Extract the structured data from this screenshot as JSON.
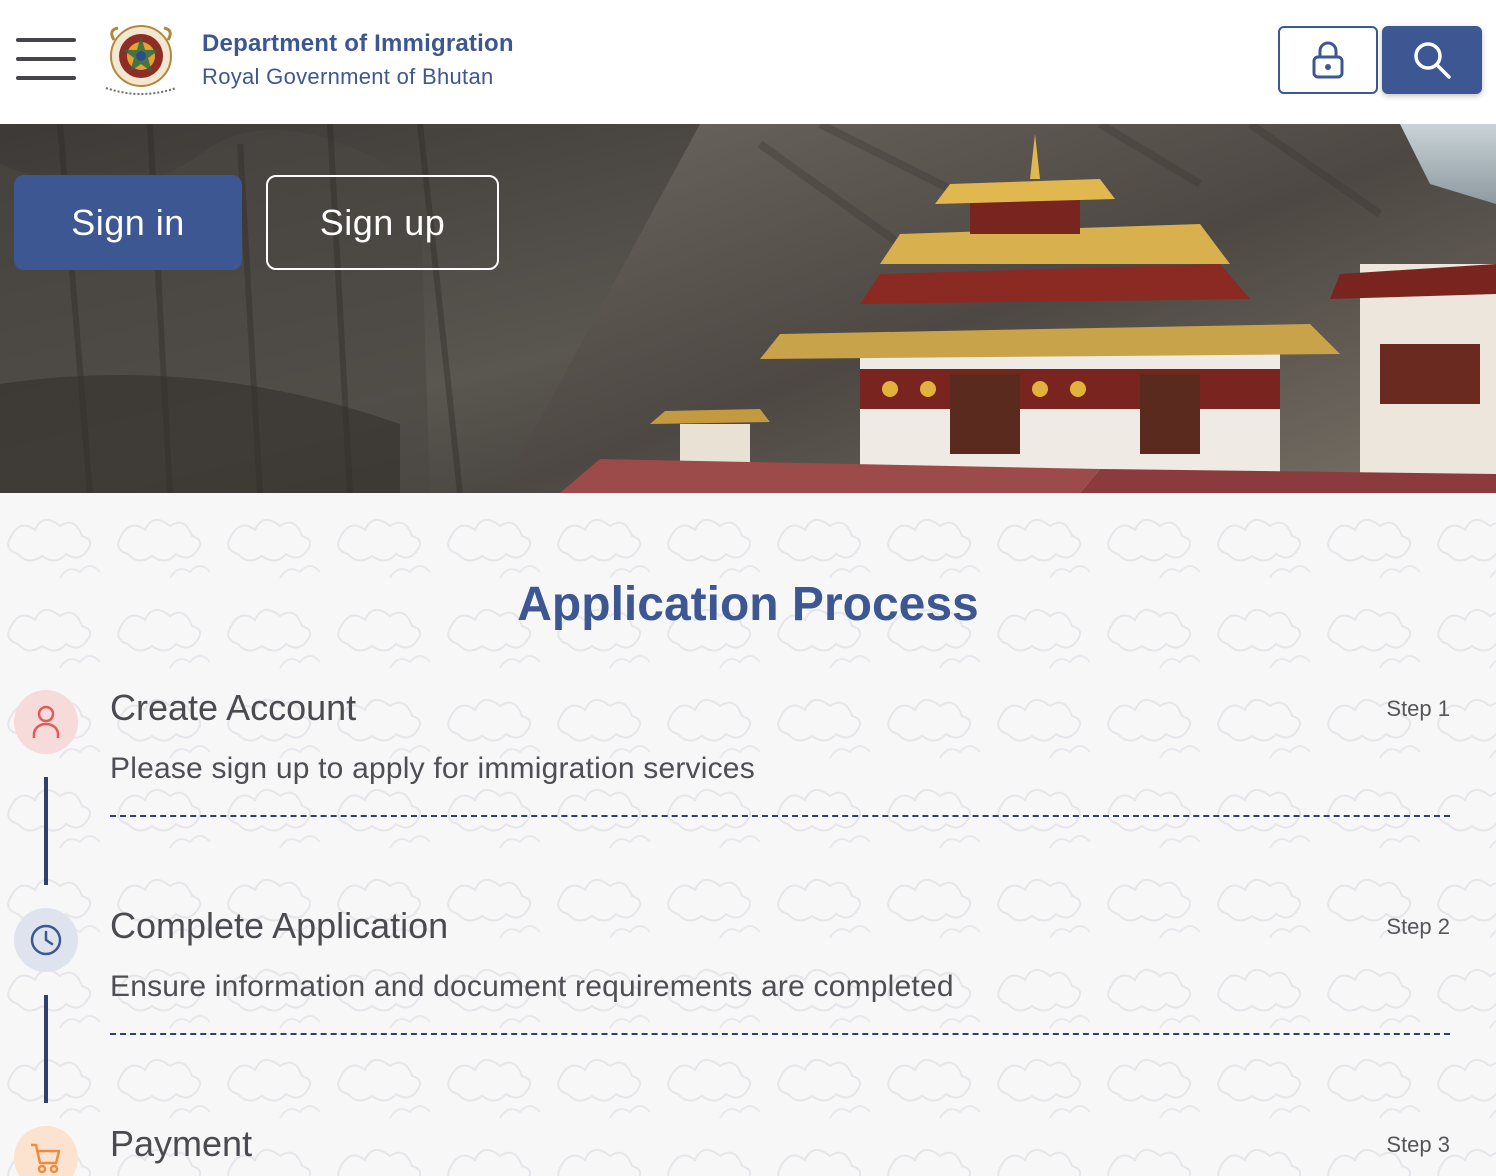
{
  "header": {
    "department": "Department of Immigration",
    "government": "Royal Government of Bhutan",
    "menu_icon": "hamburger-menu-icon",
    "emblem": "royal-emblem-of-bhutan",
    "lock_icon": "lock-icon",
    "search_icon": "search-icon"
  },
  "hero": {
    "signin_label": "Sign in",
    "signup_label": "Sign up"
  },
  "process": {
    "title": "Application Process",
    "steps": [
      {
        "title": "Create Account",
        "step": "Step 1",
        "description": "Please sign up to apply for immigration services",
        "icon": "user-icon",
        "color": "#e05a5a"
      },
      {
        "title": "Complete Application",
        "step": "Step 2",
        "description": "Ensure information and document requirements are completed",
        "icon": "clock-icon",
        "color": "#3c5792"
      },
      {
        "title": "Payment",
        "step": "Step 3",
        "description": "",
        "icon": "cart-icon",
        "color": "#f08a3c"
      }
    ]
  },
  "colors": {
    "brand": "#3c5792",
    "text": "#4a4a50",
    "background": "#f7f7f8"
  }
}
